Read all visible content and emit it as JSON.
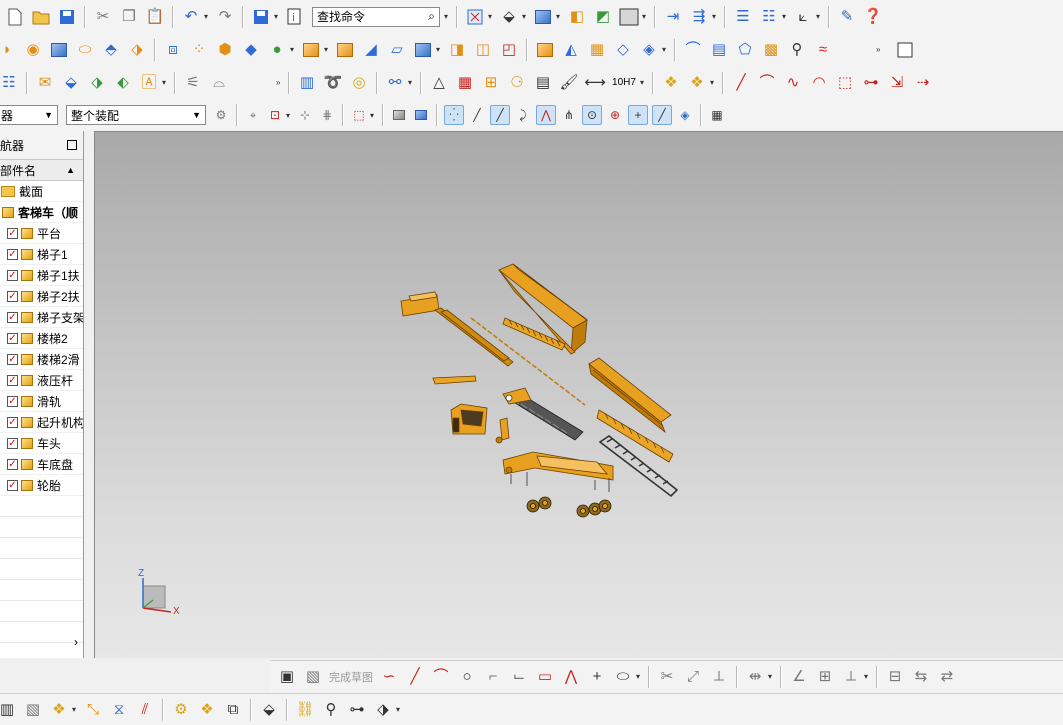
{
  "toolbar_row4": {
    "filter_value": "器",
    "assembly_scope_value": "整个装配"
  },
  "search": {
    "placeholder": "查找命令"
  },
  "navigator": {
    "title": "导航器",
    "column_header": "生部件名",
    "items": [
      {
        "label": "截面",
        "type": "folder"
      },
      {
        "label": "客梯车（顺",
        "type": "assembly"
      },
      {
        "label": "平台",
        "type": "part"
      },
      {
        "label": "梯子1",
        "type": "part"
      },
      {
        "label": "梯子1扶",
        "type": "part"
      },
      {
        "label": "梯子2扶",
        "type": "part"
      },
      {
        "label": "梯子支架",
        "type": "part"
      },
      {
        "label": "楼梯2",
        "type": "part"
      },
      {
        "label": "楼梯2滑",
        "type": "part"
      },
      {
        "label": "液压杆",
        "type": "part"
      },
      {
        "label": "滑轨",
        "type": "part"
      },
      {
        "label": "起升机构",
        "type": "part"
      },
      {
        "label": "车头",
        "type": "part"
      },
      {
        "label": "车底盘",
        "type": "part"
      },
      {
        "label": "轮胎",
        "type": "part"
      }
    ]
  },
  "viewport": {
    "triad_z": "Z",
    "triad_x": "X"
  },
  "sketch_bar": {
    "finish_sketch_label": "完成草图"
  },
  "toolbar_row3": {
    "tolerance_label": "10H7"
  },
  "colors": {
    "part_orange": "#E8A020",
    "viewport_top": "#a9a9a9",
    "viewport_bottom": "#e7e7e7"
  }
}
